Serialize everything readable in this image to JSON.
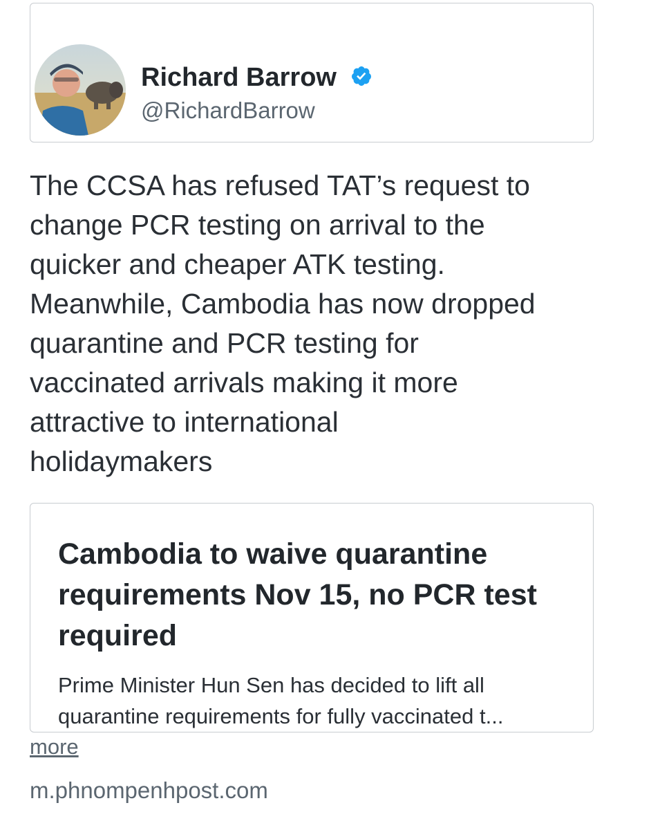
{
  "author": {
    "name": "Richard Barrow",
    "handle": "@RichardBarrow",
    "verified": true,
    "avatar_icon": "profile-photo-icon",
    "verified_icon": "verified-badge-icon",
    "verified_color": "#1da1f2"
  },
  "tweet": {
    "text": "The CCSA has refused TAT’s request to\nchange PCR testing on arrival to the\nquicker and cheaper ATK testing.\nMeanwhile, Cambodia has now dropped\nquarantine and PCR testing for\nvaccinated arrivals making it more\nattractive to international\nholidaymakers"
  },
  "link_card": {
    "title": "Cambodia to waive quarantine requirements Nov 15, no PCR test required",
    "description": "Prime Minister Hun Sen has decided to lift all quarantine requirements for fully vaccinated t..."
  },
  "more_label": "more",
  "source_domain": "m.phnompenhpost.com"
}
